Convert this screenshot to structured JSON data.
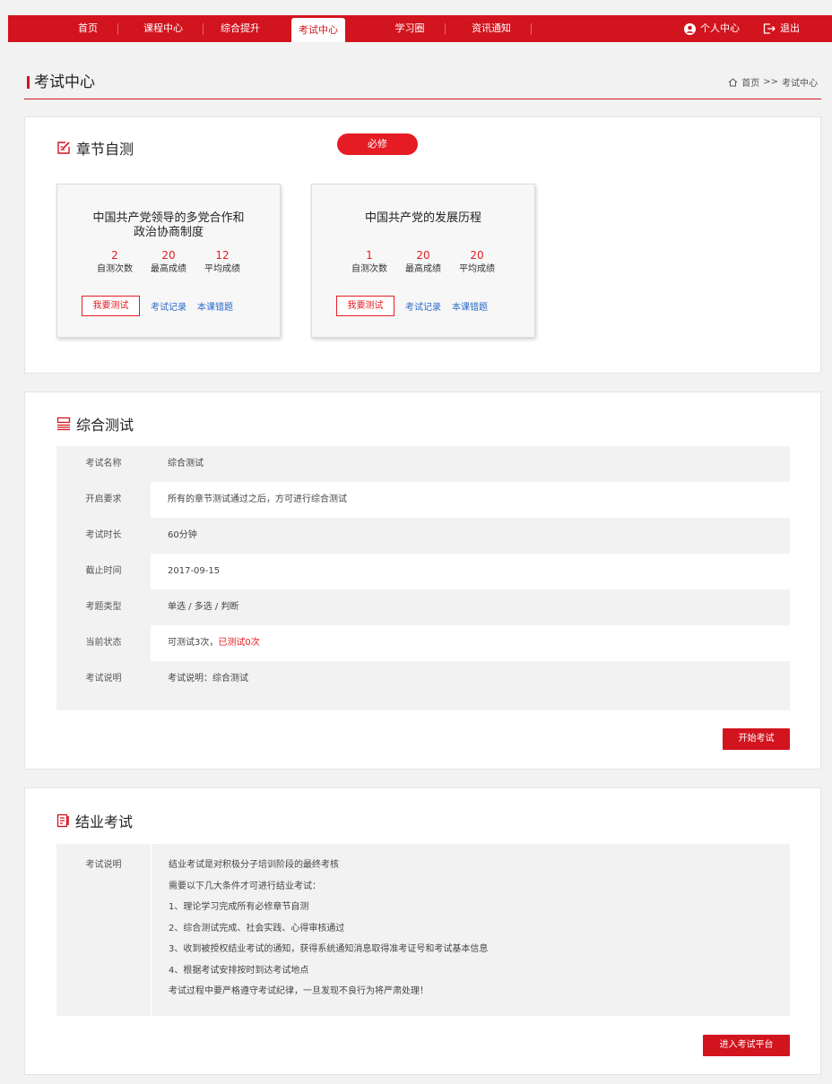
{
  "nav": {
    "items": [
      {
        "label": "首页"
      },
      {
        "label": "课程中心"
      },
      {
        "label": "综合提升"
      },
      {
        "label": "考试中心"
      },
      {
        "label": "学习圈"
      },
      {
        "label": "资讯通知"
      }
    ],
    "active": "考试中心",
    "user_center": "个人中心",
    "logout": "退出"
  },
  "header": {
    "title": "考试中心",
    "breadcrumb_home": "首页",
    "breadcrumb_sep": ">>",
    "breadcrumb_current": "考试中心"
  },
  "chapter": {
    "title": "章节自测",
    "badge": "必修",
    "cards": [
      {
        "title_line1": "中国共产党领导的多党合作和",
        "title_line2": "政治协商制度",
        "stats": [
          {
            "value": "2",
            "label": "自测次数"
          },
          {
            "value": "20",
            "label": "最高成绩"
          },
          {
            "value": "12",
            "label": "平均成绩"
          }
        ],
        "test_btn": "我要测试",
        "record_link": "考试记录",
        "wrong_link": "本课错题"
      },
      {
        "title_line1": "中国共产党的发展历程",
        "title_line2": "",
        "stats": [
          {
            "value": "1",
            "label": "自测次数"
          },
          {
            "value": "20",
            "label": "最高成绩"
          },
          {
            "value": "20",
            "label": "平均成绩"
          }
        ],
        "test_btn": "我要测试",
        "record_link": "考试记录",
        "wrong_link": "本课错题"
      }
    ]
  },
  "comprehensive": {
    "title": "综合测试",
    "rows": [
      {
        "label": "考试名称",
        "value": "综合测试"
      },
      {
        "label": "开启要求",
        "value": "所有的章节测试通过之后，方可进行综合测试"
      },
      {
        "label": "考试时长",
        "value": "60分钟"
      },
      {
        "label": "截止时间",
        "value": "2017-09-15"
      },
      {
        "label": "考题类型",
        "value": "单选 / 多选 / 判断"
      },
      {
        "label": "当前状态",
        "value": "可测试3次，",
        "value_red": "已测试0次"
      },
      {
        "label": "考试说明",
        "value": "考试说明：综合测试"
      }
    ],
    "start_btn": "开始考试"
  },
  "final": {
    "title": "结业考试",
    "label": "考试说明",
    "lines": [
      "结业考试是对积极分子培训阶段的最终考核",
      "需要以下几大条件才可进行结业考试：",
      "1、理论学习完成所有必修章节自测",
      "2、综合测试完成、社会实践、心得审核通过",
      "3、收到被授权结业考试的通知，获得系统通知消息取得准考证号和考试基本信息",
      "4、根据考试安排按时到达考试地点",
      "考试过程中要严格遵守考试纪律，一旦发现不良行为将严肃处理！"
    ],
    "enter_btn": "进入考试平台"
  },
  "colors": {
    "primary": "#d2141e",
    "link": "#2a6ac8"
  }
}
